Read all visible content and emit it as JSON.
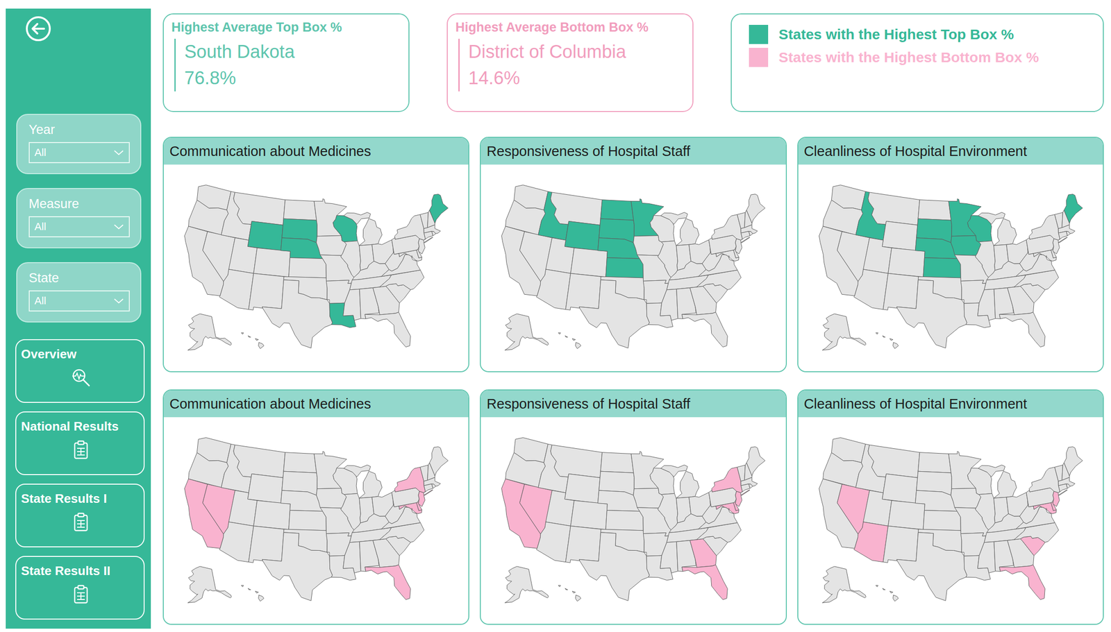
{
  "filters": [
    {
      "label": "Year",
      "value": "All"
    },
    {
      "label": "Measure",
      "value": "All"
    },
    {
      "label": "State",
      "value": "All"
    }
  ],
  "pages": [
    {
      "label": "Overview",
      "kind": "overview"
    },
    {
      "label": "National Results",
      "kind": "report"
    },
    {
      "label": "State Results I",
      "kind": "report"
    },
    {
      "label": "State Results II",
      "kind": "report"
    }
  ],
  "kpis": [
    {
      "title": "Highest Average Top Box %",
      "value": "South Dakota",
      "percent": "76.8%",
      "color": "#5ec5ae"
    },
    {
      "title": "Highest Average Bottom Box %",
      "value": "District of Columbia",
      "percent": "14.6%",
      "color": "#f19dbd"
    }
  ],
  "legend": [
    {
      "label": "States with the Highest Top Box %",
      "kind": "top",
      "color": "#35b898"
    },
    {
      "label": "States with the Highest Bottom Box %",
      "kind": "bottom",
      "color": "#f9b3cf"
    }
  ],
  "maps": [
    {
      "title": "Communication about Medicines",
      "kind": "top",
      "highlighted": [
        "WY",
        "SD",
        "NE",
        "WI",
        "ME",
        "LA"
      ]
    },
    {
      "title": "Responsiveness of Hospital Staff",
      "kind": "top",
      "highlighted": [
        "ID",
        "WY",
        "ND",
        "SD",
        "NE",
        "KS",
        "MN"
      ]
    },
    {
      "title": "Cleanliness of Hospital Environment",
      "kind": "top",
      "highlighted": [
        "ID",
        "SD",
        "NE",
        "KS",
        "MN",
        "IA",
        "WI",
        "ME"
      ]
    },
    {
      "title": "Communication about Medicines",
      "kind": "bottom",
      "highlighted": [
        "CA",
        "NV",
        "NY",
        "NJ",
        "MD",
        "DE",
        "DC",
        "FL"
      ]
    },
    {
      "title": "Responsiveness of Hospital Staff",
      "kind": "bottom",
      "highlighted": [
        "CA",
        "NV",
        "NY",
        "NJ",
        "MD",
        "DE",
        "DC",
        "GA",
        "FL"
      ]
    },
    {
      "title": "Cleanliness of Hospital Environment",
      "kind": "bottom",
      "highlighted": [
        "NV",
        "AZ",
        "NJ",
        "MD",
        "DE",
        "DC",
        "SC",
        "FL"
      ]
    }
  ]
}
